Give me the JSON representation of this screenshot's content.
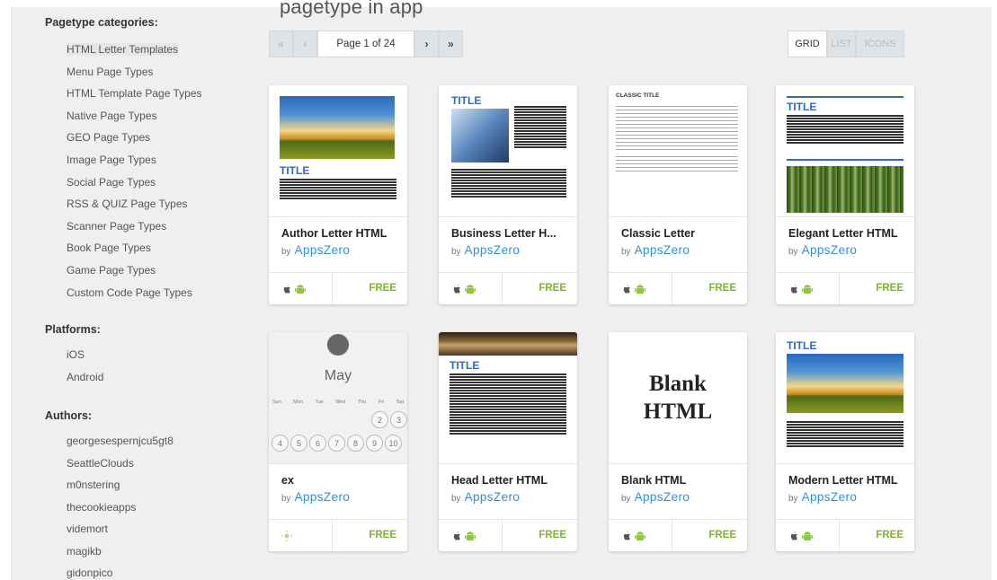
{
  "top_text": "pagetype in app",
  "sidebar": {
    "categories_heading": "Pagetype categories:",
    "categories": [
      "HTML Letter Templates",
      "Menu Page Types",
      "HTML Template Page Types",
      "Native Page Types",
      "GEO Page Types",
      "Image Page Types",
      "Social Page Types",
      "RSS & QUIZ Page Types",
      "Scanner Page Types",
      "Book Page Types",
      "Game Page Types",
      "Custom Code Page Types"
    ],
    "platforms_heading": "Platforms:",
    "platforms": [
      "iOS",
      "Android"
    ],
    "authors_heading": "Authors:",
    "authors": [
      "georgesespernjcu5gt8",
      "SeattleClouds",
      "m0nstering",
      "thecookieapps",
      "videmort",
      "magikb",
      "gidonpico"
    ]
  },
  "pager": {
    "first": "«",
    "prev": "‹",
    "page_label": "Page 1 of 24",
    "next": "›",
    "last": "»"
  },
  "view": {
    "options": [
      "GRID",
      "LIST",
      "ICONS"
    ],
    "active": "GRID"
  },
  "author_prefix": "by",
  "cards": [
    {
      "title": "Author Letter HTML",
      "author": "AppsZero",
      "price": "FREE",
      "platforms": [
        "apple-icon",
        "android-icon"
      ]
    },
    {
      "title": "Business Letter H...",
      "author": "AppsZero",
      "price": "FREE",
      "platforms": [
        "apple-icon",
        "android-icon"
      ]
    },
    {
      "title": "Classic Letter",
      "author": "AppsZero",
      "price": "FREE",
      "platforms": [
        "apple-icon",
        "android-icon"
      ]
    },
    {
      "title": "Elegant Letter HTML",
      "author": "AppsZero",
      "price": "FREE",
      "platforms": [
        "apple-icon",
        "android-icon"
      ]
    },
    {
      "title": "ex",
      "author": "AppsZero",
      "price": "FREE",
      "platforms": [
        "web-icon"
      ]
    },
    {
      "title": "Head Letter HTML",
      "author": "AppsZero",
      "price": "FREE",
      "platforms": [
        "apple-icon",
        "android-icon"
      ]
    },
    {
      "title": "Blank HTML",
      "author": "AppsZero",
      "price": "FREE",
      "platforms": [
        "apple-icon",
        "android-icon"
      ]
    },
    {
      "title": "Modern Letter HTML",
      "author": "AppsZero",
      "price": "FREE",
      "platforms": [
        "apple-icon",
        "android-icon"
      ]
    }
  ],
  "thumbs": {
    "title_word": "TITLE",
    "classic_title": "CLASSIC TITLE",
    "blank_text_1": "Blank",
    "blank_text_2": "HTML",
    "cal_month": "May",
    "cal_days": [
      "Sun",
      "Mon",
      "Tue",
      "Wed",
      "Thu",
      "Fri",
      "Sat"
    ],
    "cal_nums": [
      "2",
      "3",
      "4",
      "5",
      "6",
      "7",
      "8",
      "9",
      "10"
    ]
  },
  "colors": {
    "accent_blue": "#2e8fe0",
    "free_green": "#7cb531",
    "android_green": "#8dc63f"
  }
}
